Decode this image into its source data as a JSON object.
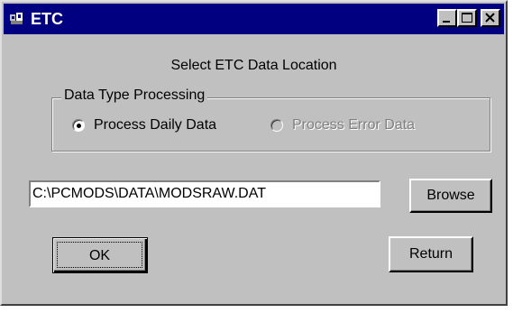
{
  "window": {
    "title": "ETC"
  },
  "icons": {
    "app": "app-icon",
    "minimize": "minimize-icon",
    "maximize": "maximize-icon",
    "close": "close-icon"
  },
  "heading": "Select ETC Data Location",
  "data_type_group": {
    "label": "Data Type Processing",
    "options": [
      {
        "label": "Process Daily Data",
        "selected": true,
        "enabled": true
      },
      {
        "label": "Process Error Data",
        "selected": false,
        "enabled": false
      }
    ]
  },
  "path_field": {
    "value": "C:\\PCMODS\\DATA\\MODSRAW.DAT"
  },
  "buttons": {
    "browse": "Browse",
    "ok": "OK",
    "return": "Return"
  },
  "colors": {
    "titlebar": "#000080",
    "face": "#c0c0c0"
  }
}
